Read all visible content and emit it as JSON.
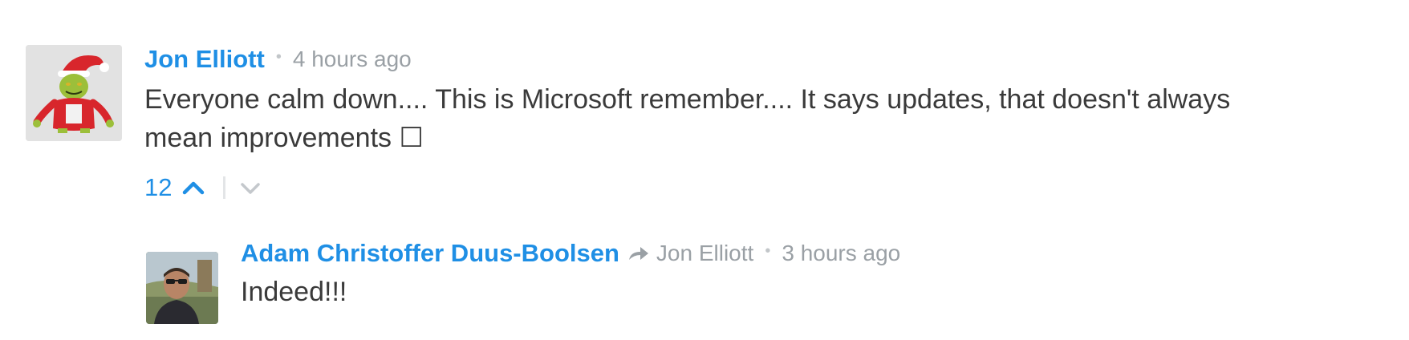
{
  "comments": [
    {
      "author": "Jon Elliott",
      "timestamp": "4 hours ago",
      "body_line1": "Everyone calm down.... This is Microsoft remember.... It says updates, that doesn't always",
      "body_line2": "mean improvements ☐",
      "upvotes": "12",
      "avatar_icon": "grinch-avatar-icon"
    }
  ],
  "replies": [
    {
      "author": "Adam Christoffer Duus-Boolsen",
      "in_reply_to": "Jon Elliott",
      "timestamp": "3 hours ago",
      "body": "Indeed!!!",
      "avatar_icon": "person-photo-avatar-icon"
    }
  ],
  "colors": {
    "link_blue": "#1f8fe5",
    "meta_gray": "#9aa0a5",
    "text_dark": "#3a3a3a"
  }
}
